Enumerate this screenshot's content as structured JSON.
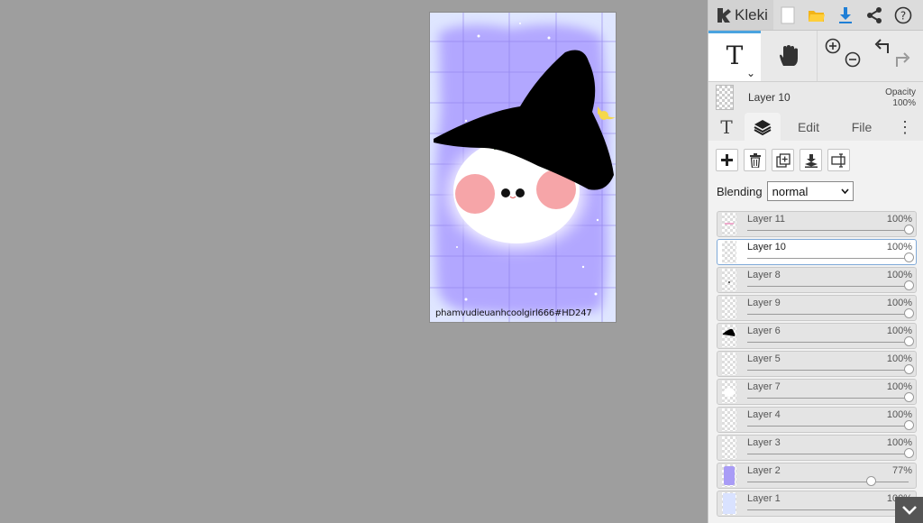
{
  "app": {
    "name": "Kleki"
  },
  "topbar": {
    "icons": [
      "new-file-icon",
      "open-folder-icon",
      "download-icon",
      "share-icon",
      "help-icon"
    ]
  },
  "tools": {
    "active": "text",
    "items": [
      "text-tool",
      "hand-tool",
      "zoom",
      "undo-redo"
    ]
  },
  "active_layer": {
    "name": "Layer 10",
    "opacity_label": "Opacity",
    "opacity_value": "100%"
  },
  "tabs": {
    "edit": "Edit",
    "file": "File"
  },
  "blending": {
    "label": "Blending",
    "value": "normal"
  },
  "layers": [
    {
      "name": "Layer 11",
      "opacity": "100%",
      "level": 1.0,
      "active": false,
      "thumb": "line"
    },
    {
      "name": "Layer 10",
      "opacity": "100%",
      "level": 1.0,
      "active": true,
      "thumb": "empty"
    },
    {
      "name": "Layer 8",
      "opacity": "100%",
      "level": 1.0,
      "active": false,
      "thumb": "dot"
    },
    {
      "name": "Layer 9",
      "opacity": "100%",
      "level": 1.0,
      "active": false,
      "thumb": "empty"
    },
    {
      "name": "Layer 6",
      "opacity": "100%",
      "level": 1.0,
      "active": false,
      "thumb": "hat"
    },
    {
      "name": "Layer 5",
      "opacity": "100%",
      "level": 1.0,
      "active": false,
      "thumb": "empty"
    },
    {
      "name": "Layer 7",
      "opacity": "100%",
      "level": 1.0,
      "active": false,
      "thumb": "white"
    },
    {
      "name": "Layer 4",
      "opacity": "100%",
      "level": 1.0,
      "active": false,
      "thumb": "empty"
    },
    {
      "name": "Layer 3",
      "opacity": "100%",
      "level": 1.0,
      "active": false,
      "thumb": "empty"
    },
    {
      "name": "Layer 2",
      "opacity": "77%",
      "level": 0.77,
      "active": false,
      "thumb": "purple"
    },
    {
      "name": "Layer 1",
      "opacity": "100%",
      "level": 1.0,
      "active": false,
      "thumb": "lightblue"
    }
  ],
  "canvas": {
    "watermark": "phamvudieuanhcoolgirl666#HD247"
  },
  "colors": {
    "panel_bg": "#e9e9e9",
    "workspace_bg": "#9e9e9e",
    "accent_blue": "#4aa3df",
    "background_purple": "#b3a8ff",
    "grid_lines": "#8d7fe8",
    "hat": "#000000",
    "blush": "#f6a5a8",
    "moon": "#f5d84b"
  }
}
